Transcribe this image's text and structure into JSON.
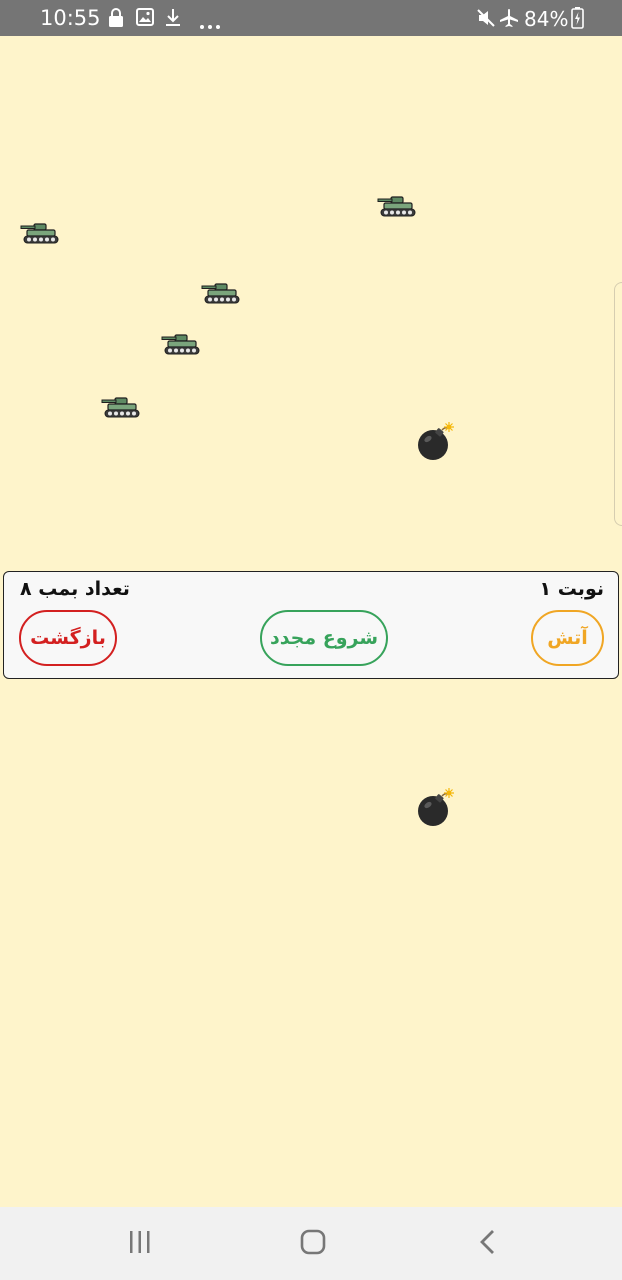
{
  "status_bar": {
    "time": "10:55",
    "left_icons": [
      "lock-icon",
      "image-icon",
      "download-icon",
      "more-dots-icon"
    ],
    "right_icons": [
      "mute-icon",
      "airplane-mode-icon",
      "battery-charging-icon"
    ],
    "battery": "84%"
  },
  "game_area": {
    "tanks": [
      "tank-icon",
      "tank-icon",
      "tank-icon",
      "tank-icon",
      "tank-icon"
    ],
    "bombs": [
      "bomb-icon",
      "bomb-icon"
    ]
  },
  "control_panel": {
    "turn_label": "نوبت ۱",
    "bomb_count_label": "تعداد بمب ۸",
    "back_button": "بازگشت",
    "restart_button": "شروع مجدد",
    "fire_button": "آتش"
  },
  "colors": {
    "background": "#fef4cb",
    "back": "#d32020",
    "restart": "#37a35b",
    "fire": "#f0a624"
  },
  "nav_bar": {
    "icons": [
      "recent-apps-icon",
      "home-icon",
      "back-arrow-icon"
    ]
  }
}
